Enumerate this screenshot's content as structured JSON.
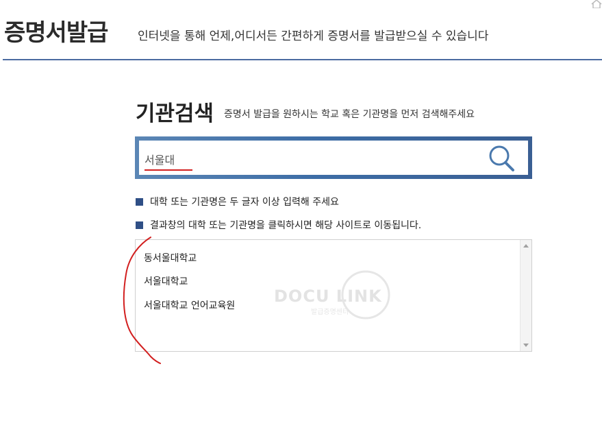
{
  "header": {
    "title": "증명서발급",
    "subtitle": "인터넷을 통해 언제,어디서든 간편하게 증명서를 발급받으실 수 있습니다"
  },
  "search_section": {
    "title": "기관검색",
    "subtitle": "증명서 발급을 원하시는 학교 혹은 기관명을 먼저 검색해주세요",
    "input_value": "서울대"
  },
  "notes": [
    "대학 또는 기관명은 두 글자 이상 입력해 주세요",
    "결과창의 대학 또는 기관명을 클릭하시면 해당 사이트로 이동됩니다."
  ],
  "results": [
    "동서울대학교",
    "서울대학교",
    "서울대학교 언어교육원"
  ],
  "watermark": {
    "text": "DOCU LINK",
    "subtext": "발급증명센터"
  },
  "colors": {
    "accent": "#3d6da6",
    "bullet": "#2f4f86",
    "annotation": "#d21f1f"
  },
  "icons": {
    "home": "home-icon",
    "search": "search-icon"
  }
}
